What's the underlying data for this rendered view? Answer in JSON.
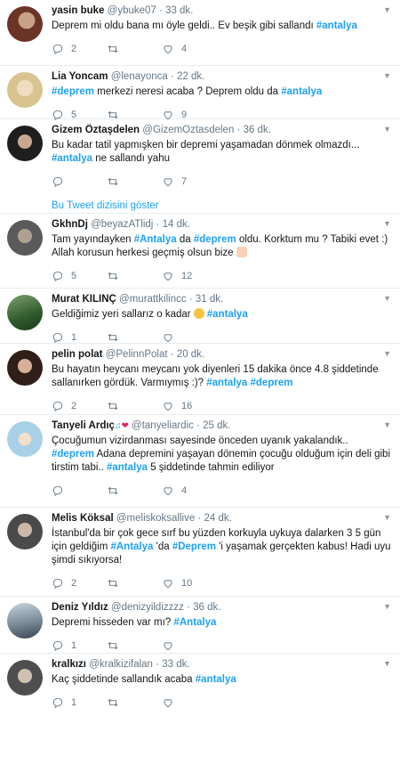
{
  "tweets": [
    {
      "name": "yasin buke",
      "handle": "@ybuke07",
      "time": "33 dk.",
      "text": "Deprem mi oldu bana mı öyle geldi.. Ev beşik gibi sallandı ",
      "tag1": "#antalya",
      "replies": "2",
      "retweets": "",
      "likes": "4",
      "avatar_color": "#7a3b2e"
    },
    {
      "name": "Lia Yoncam",
      "handle": "@lenayonca",
      "time": "22 dk.",
      "tag1": "#deprem",
      "text": " merkezi neresi acaba ? Deprem oldu da ",
      "tag2": "#antalya",
      "replies": "5",
      "retweets": "",
      "likes": "9",
      "avatar_color": "#d8c8a0"
    },
    {
      "name": "Gizem Öztaşdelen",
      "handle": "@GizemOztasdelen",
      "time": "36 dk.",
      "text": "Bu kadar tatil yapmışken bir depremi yaşamadan dönmek olmazdı... ",
      "tag1": "#antalya",
      "text2": " ne sallandı yahu",
      "replies": "",
      "retweets": "",
      "likes": "7",
      "thread_link": "Bu Tweet dizisini göster",
      "avatar_color": "#2a2a2a"
    },
    {
      "name": "GkhnDj",
      "handle": "@beyazATlidj",
      "time": "14 dk.",
      "text": "Tam yayındayken ",
      "tag1": "#Antalya",
      "text2": " da  ",
      "tag2": "#deprem",
      "text3": " oldu. Korktum mu ? Tabiki evet :) Allah korusun herkesi geçmiş olsun bize ",
      "replies": "5",
      "retweets": "",
      "likes": "12",
      "avatar_color": "#6a6a6a"
    },
    {
      "name": "Murat KILINÇ",
      "handle": "@murattkilincc",
      "time": "31 dk.",
      "text": "Geldiğimiz yeri sallarız o kadar ",
      "tag1": "#antalya",
      "replies": "1",
      "retweets": "",
      "likes": "",
      "avatar_color": "#3d6b3a"
    },
    {
      "name": "pelin polat",
      "handle": "@PelinnPolat",
      "time": "20 dk.",
      "text": "Bu hayatın heycanı meycanı yok diyenleri 15 dakika önce 4.8 şiddetinde sallanırken gördük. Varmıymış :)? ",
      "tag1": "#antalya",
      "tag2": "#deprem",
      "replies": "2",
      "retweets": "",
      "likes": "16",
      "avatar_color": "#3a2a20"
    },
    {
      "name": "Tanyeli Ardıç",
      "handle": "@tanyeliardic",
      "time": "25 dk.",
      "text": "Çocuğumun vizirdanması sayesinde önceden uyanık yakalandık.. ",
      "tag1": "#deprem",
      "text2": " Adana depremini yaşayan dönemin çocuğu olduğum için deli gibi tirstim tabi.. ",
      "tag2": "#antalya",
      "text3": " 5 şiddetinde tahmin ediliyor",
      "replies": "",
      "retweets": "",
      "likes": "4",
      "avatar_color": "#b8d8e8"
    },
    {
      "name": "Melis Köksal",
      "handle": "@meliskoksallive",
      "time": "24 dk.",
      "text": "İstanbul'da bir çok gece sırf bu yüzden korkuyla uykuya dalarken  3 5 gün için geldiğim ",
      "tag1": "#Antalya",
      "text2": " 'da ",
      "tag2": "#Deprem",
      "text3": " 'i  yaşamak gerçekten kabus! Hadi uyu şimdi sıkıyorsa!",
      "replies": "2",
      "retweets": "",
      "likes": "10",
      "avatar_color": "#5a5a5a"
    },
    {
      "name": "Deniz Yıldız",
      "handle": "@denizyildizzzz",
      "time": "36 dk.",
      "text": "Depremi hisseden var mı? ",
      "tag1": "#Antalya",
      "replies": "1",
      "retweets": "",
      "likes": "",
      "avatar_color": "#8a9aa8"
    },
    {
      "name": "kralkızı",
      "handle": "@kralkizifalan",
      "time": "33 dk.",
      "text": "Kaç şiddetinde sallandık acaba ",
      "tag1": "#antalya",
      "replies": "1",
      "retweets": "",
      "likes": "",
      "avatar_color": "#555555"
    }
  ],
  "separator": " · ",
  "colors": {
    "link": "#1da1f2",
    "muted": "#657786"
  }
}
